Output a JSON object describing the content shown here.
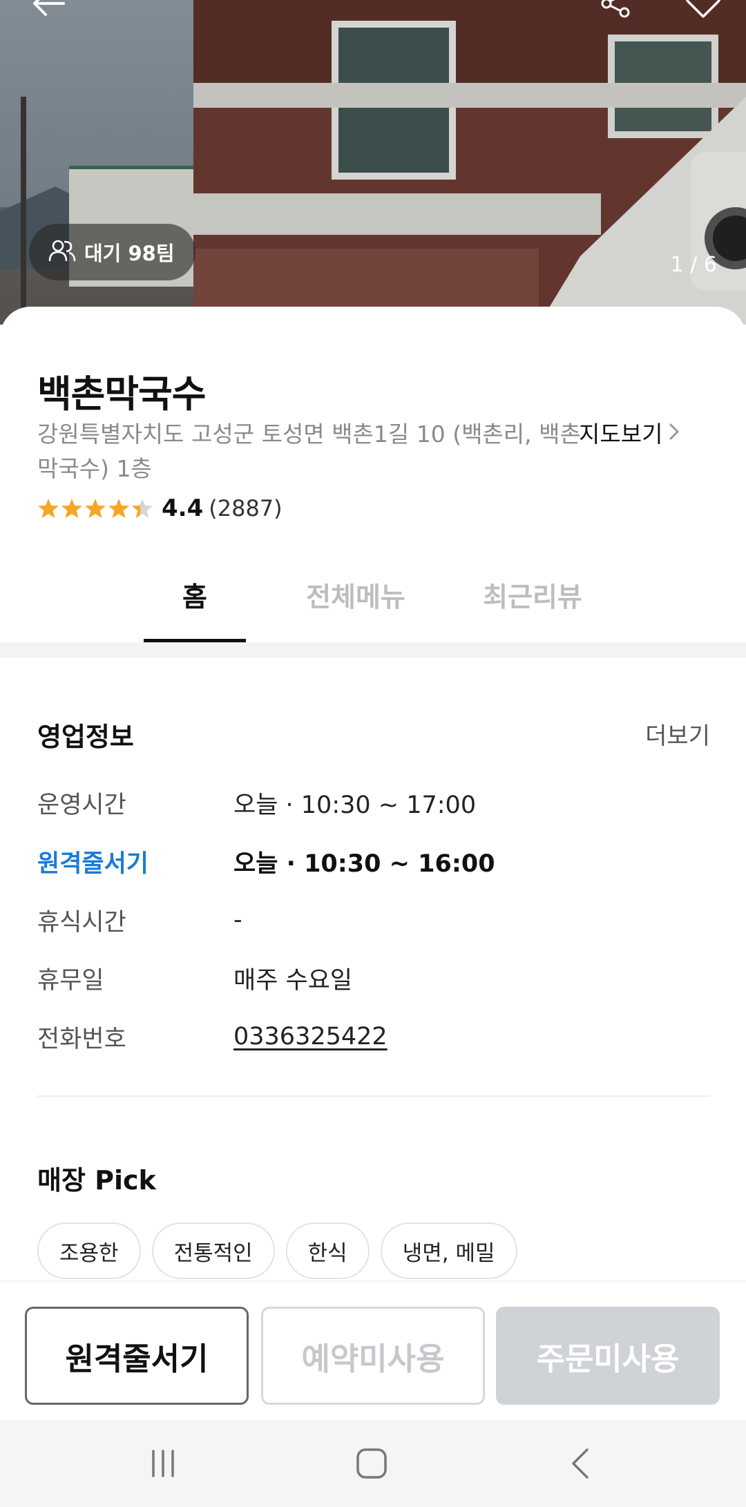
{
  "hero": {
    "wait_badge_label": "대기 98팀",
    "photo_counter": "1 / 6"
  },
  "store": {
    "name": "백촌막국수",
    "address": "강원특별자치도 고성군 토성면 백촌1길 10 (백촌리, 백촌막국수) 1층",
    "map_link": "지도보기",
    "rating_score": "4.4",
    "review_count": "(2887)",
    "rating_value": 4.4,
    "rating_max": 5
  },
  "tabs": [
    {
      "label": "홈",
      "active": true
    },
    {
      "label": "전체메뉴",
      "active": false
    },
    {
      "label": "최근리뷰",
      "active": false
    }
  ],
  "business_info": {
    "title": "영업정보",
    "more": "더보기",
    "rows": [
      {
        "label": "운영시간",
        "value": "오늘 · 10:30 ~ 17:00"
      },
      {
        "label": "원격줄서기",
        "value": "오늘 · 10:30 ~ 16:00"
      },
      {
        "label": "휴식시간",
        "value": "-"
      },
      {
        "label": "휴무일",
        "value": "매주 수요일"
      },
      {
        "label": "전화번호",
        "value": "0336325422"
      }
    ]
  },
  "store_pick": {
    "title": "매장 Pick",
    "chips": [
      "조용한",
      "전통적인",
      "한식",
      "냉면, 메밀"
    ]
  },
  "actions": {
    "remote_queue": "원격줄서기",
    "reservation": "예약미사용",
    "order": "주문미사용"
  },
  "colors": {
    "accent_blue": "#1a7ad6",
    "star": "#f5a623",
    "disabled": "#cfd2d6"
  },
  "icons": {
    "back": "arrow-left-icon",
    "share": "share-icon",
    "favorite": "heart-icon",
    "people": "people-icon",
    "chevron": "chevron-right-icon",
    "nav_recents": "recents-icon",
    "nav_home": "home-icon",
    "nav_back": "back-icon"
  }
}
